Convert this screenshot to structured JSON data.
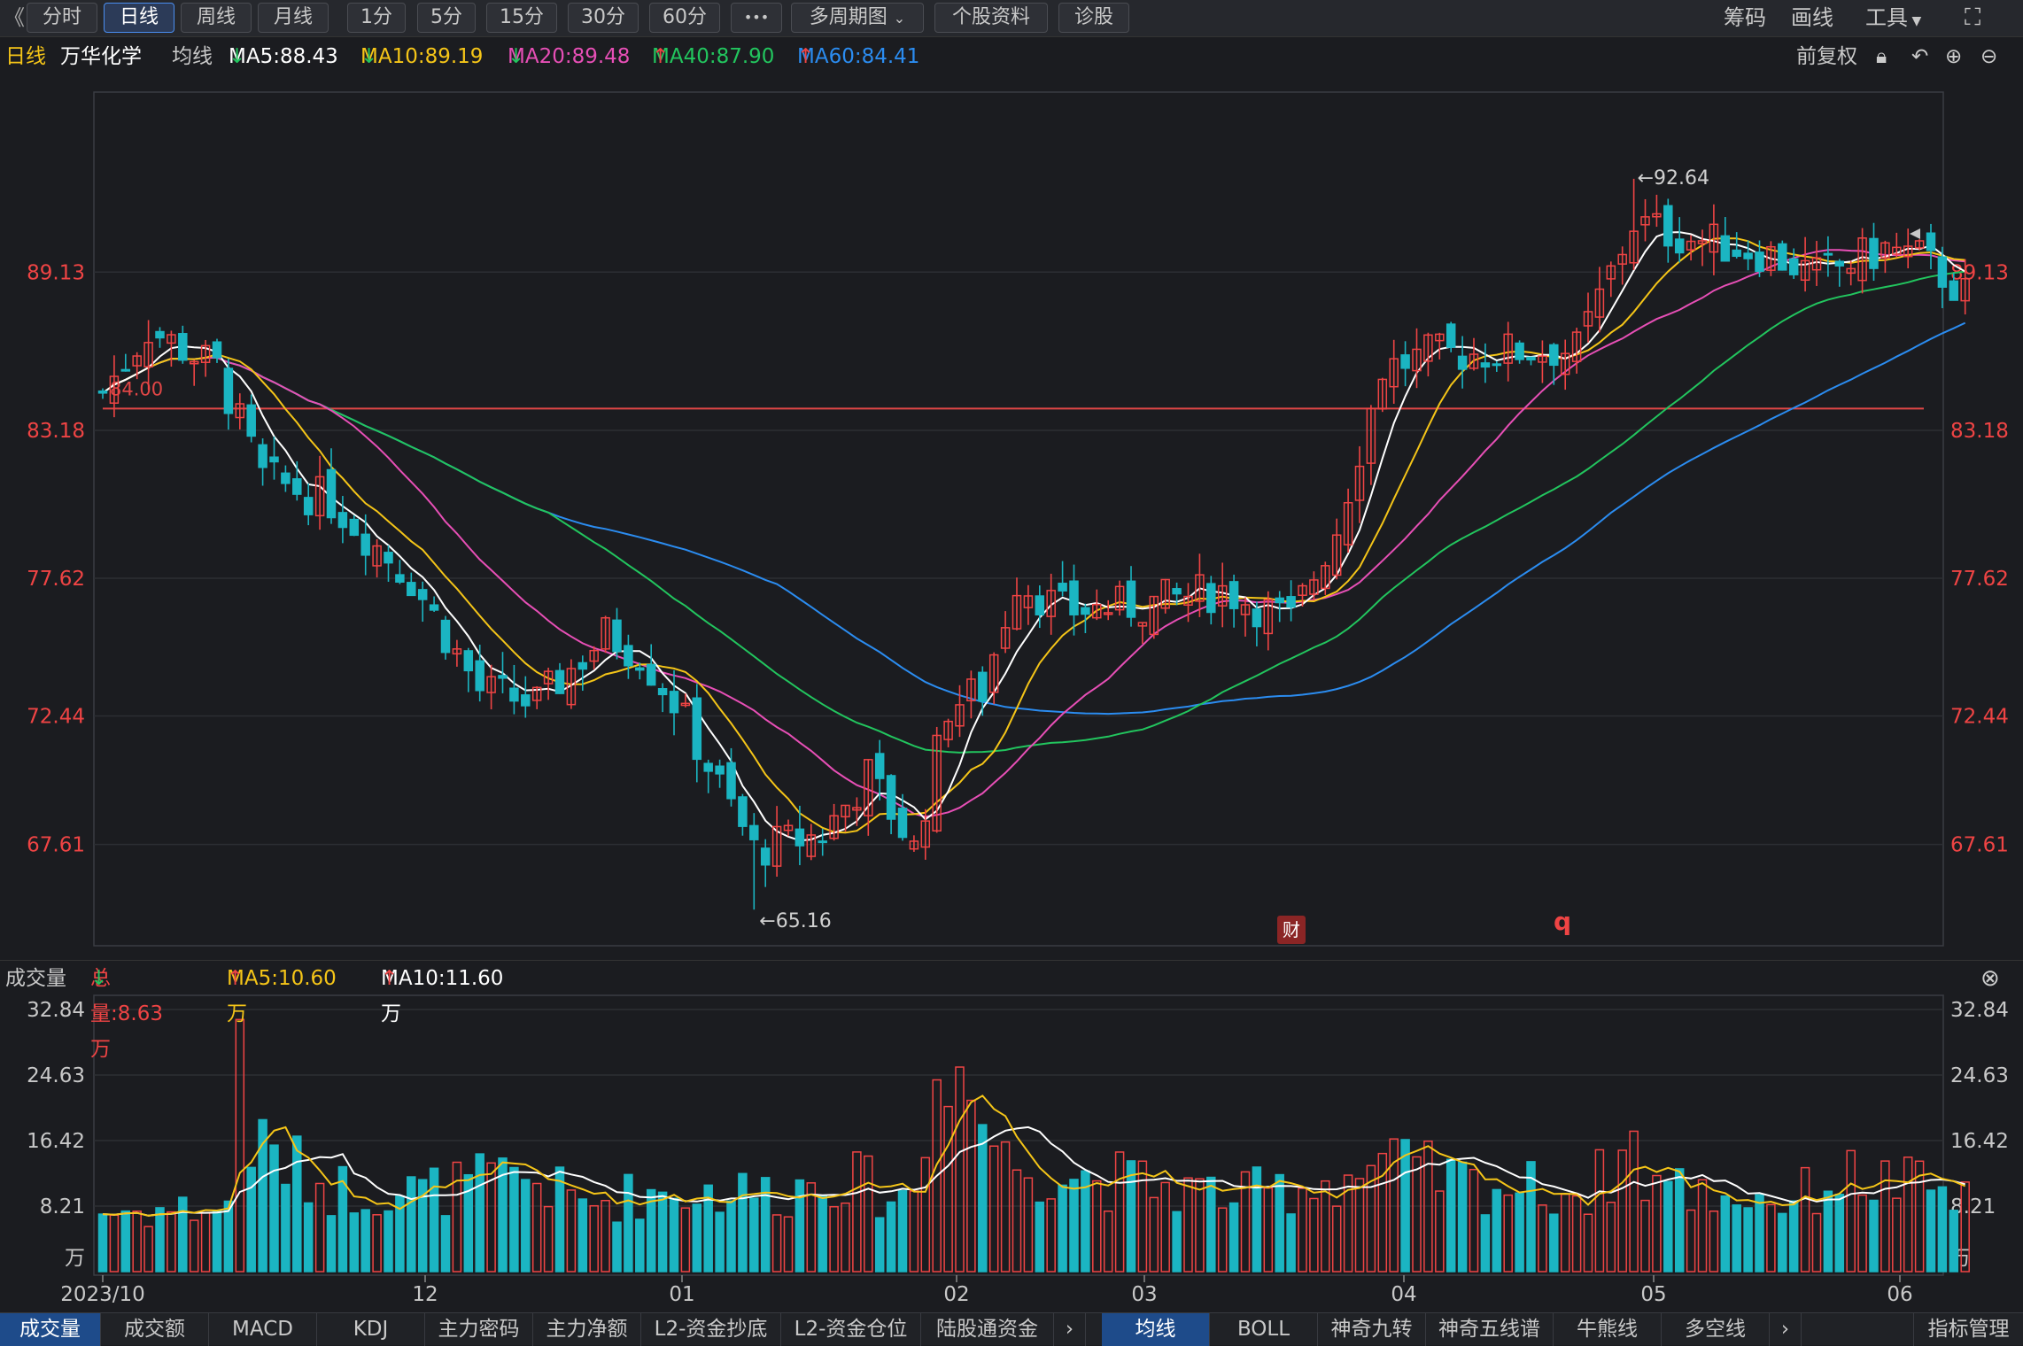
{
  "toolbar": {
    "back": "《",
    "periods": [
      "分时",
      "日线",
      "周线",
      "月线",
      "1分",
      "5分",
      "15分",
      "30分",
      "60分"
    ],
    "more": "•••",
    "multi": "多周期图",
    "profile": "个股资料",
    "diag": "诊股",
    "chips": "筹码",
    "draw": "画线",
    "tools": "工具"
  },
  "legend": {
    "period": "日线",
    "name": "万华化学",
    "ma_label": "均线",
    "ma5": "MA5:88.43",
    "ma10": "MA10:89.19",
    "ma20": "MA20:89.48",
    "ma40": "MA40:87.90",
    "ma60": "MA60:84.41",
    "adjust": "前复权"
  },
  "colors": {
    "up": "#ef4444",
    "down": "#1bb5c2",
    "ma5": "#ffffff",
    "ma10": "#f5c518",
    "ma20": "#e74fb6",
    "ma40": "#22c55e",
    "ma60": "#2b8cf0",
    "hline": "#e04646"
  },
  "markers": {
    "cai": "财",
    "q": "q"
  },
  "volume": {
    "label": "成交量",
    "total": "总量:8.63万",
    "ma5": "MA5:10.60万",
    "ma10": "MA10:11.60万",
    "unit": "万"
  },
  "tabs_left": [
    "成交量",
    "成交额",
    "MACD",
    "KDJ",
    "主力密码",
    "主力净额",
    "L2-资金抄底",
    "L2-资金仓位",
    "陆股通资金"
  ],
  "tabs_right": [
    "均线",
    "BOLL",
    "神奇九转",
    "神奇五线谱",
    "牛熊线",
    "多空线"
  ],
  "indicator_manage": "指标管理",
  "chart_data": {
    "type": "candlestick",
    "price_ticks": [
      "89.13",
      "83.18",
      "77.62",
      "72.44",
      "67.61"
    ],
    "volume_ticks": [
      "32.84",
      "24.63",
      "16.42",
      "8.21"
    ],
    "x_ticks": [
      "2023/10",
      "12",
      "01",
      "02",
      "03",
      "04",
      "05",
      "06"
    ],
    "ref_line": "84.00",
    "annotations": {
      "high": "←92.64",
      "low": "←65.16"
    },
    "ylim": [
      63.8,
      95.9
    ],
    "vol_ylim": [
      0,
      32.84
    ],
    "keyframes": [
      [
        0,
        84.6
      ],
      [
        4,
        87.0
      ],
      [
        10,
        85.5
      ],
      [
        14,
        81.4
      ],
      [
        20,
        80.5
      ],
      [
        27,
        77.6
      ],
      [
        33,
        73.4
      ],
      [
        38,
        72.9
      ],
      [
        44,
        75.5
      ],
      [
        47,
        74.8
      ],
      [
        50,
        73.0
      ],
      [
        57,
        67.4
      ],
      [
        63,
        68.0
      ],
      [
        67,
        70.2
      ],
      [
        70,
        68.2
      ],
      [
        71,
        67.4
      ],
      [
        74,
        72.8
      ],
      [
        77,
        73.4
      ],
      [
        80,
        77.6
      ],
      [
        84,
        76.4
      ],
      [
        91,
        76.6
      ],
      [
        98,
        77.2
      ],
      [
        104,
        76.0
      ],
      [
        108,
        79.5
      ],
      [
        112,
        85.5
      ],
      [
        116,
        86.0
      ],
      [
        125,
        86.2
      ],
      [
        129,
        86.2
      ],
      [
        134,
        91.0
      ],
      [
        138,
        90.5
      ],
      [
        146,
        89.8
      ],
      [
        150,
        89.0
      ],
      [
        156,
        90.0
      ],
      [
        159,
        89.7
      ],
      [
        163,
        88.3
      ]
    ],
    "vol_keyframes": [
      [
        0,
        7.5
      ],
      [
        11,
        8.0
      ],
      [
        12,
        33.0
      ],
      [
        13,
        16.0
      ],
      [
        20,
        10.5
      ],
      [
        28,
        10.0
      ],
      [
        37,
        12.0
      ],
      [
        42,
        8.5
      ],
      [
        48,
        10.0
      ],
      [
        60,
        10.0
      ],
      [
        64,
        12.5
      ],
      [
        70,
        9.0
      ],
      [
        72,
        14.0
      ],
      [
        73,
        32.0
      ],
      [
        76,
        22.0
      ],
      [
        79,
        14.0
      ],
      [
        86,
        12.0
      ],
      [
        91,
        11.0
      ],
      [
        100,
        9.5
      ],
      [
        109,
        12.0
      ],
      [
        112,
        13.5
      ],
      [
        120,
        11.0
      ],
      [
        130,
        10.0
      ],
      [
        134,
        16.0
      ],
      [
        135,
        12.0
      ],
      [
        139,
        10.0
      ],
      [
        148,
        9.0
      ],
      [
        152,
        12.0
      ],
      [
        160,
        10.5
      ],
      [
        163,
        8.6
      ]
    ]
  }
}
